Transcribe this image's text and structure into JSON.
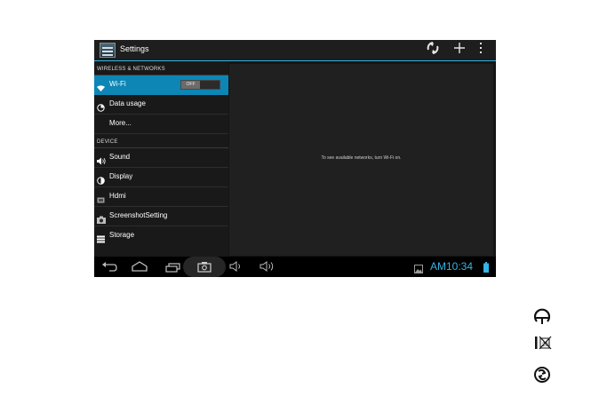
{
  "app": {
    "title": "Settings",
    "icon": "settings-app-icon"
  },
  "actionbar": {
    "icons": [
      "sync-icon",
      "add-icon",
      "overflow-menu-icon"
    ]
  },
  "sidebar": {
    "categories": [
      "WIRELESS & NETWORKS",
      "DEVICE"
    ],
    "items": [
      {
        "label": "Wi-Fi",
        "icon": "wifi-icon",
        "selected": true,
        "toggle": "OFF"
      },
      {
        "label": "Data usage",
        "icon": "data-usage-icon"
      },
      {
        "label": "More..."
      },
      {
        "label": "Sound",
        "icon": "sound-icon"
      },
      {
        "label": "Display",
        "icon": "display-icon"
      },
      {
        "label": "Hdmi",
        "icon": "hdmi-icon"
      },
      {
        "label": "ScreenshotSetting",
        "icon": "camera-icon"
      },
      {
        "label": "Storage",
        "icon": "storage-icon"
      }
    ]
  },
  "content": {
    "message": "To see available networks, turn Wi-Fi on."
  },
  "navbar": {
    "icons": [
      "back-icon",
      "home-icon",
      "recents-icon",
      "screenshot-icon",
      "volume-down-icon",
      "volume-up-icon",
      "gallery-notification-icon",
      "battery-icon"
    ],
    "time": "AM10:34"
  },
  "certifications": [
    "ce-mark-icon",
    "weee-icon",
    "recycle-icon"
  ],
  "colors": {
    "accent": "#33b5e5",
    "selected": "#0d86b5",
    "background": "#151515"
  }
}
